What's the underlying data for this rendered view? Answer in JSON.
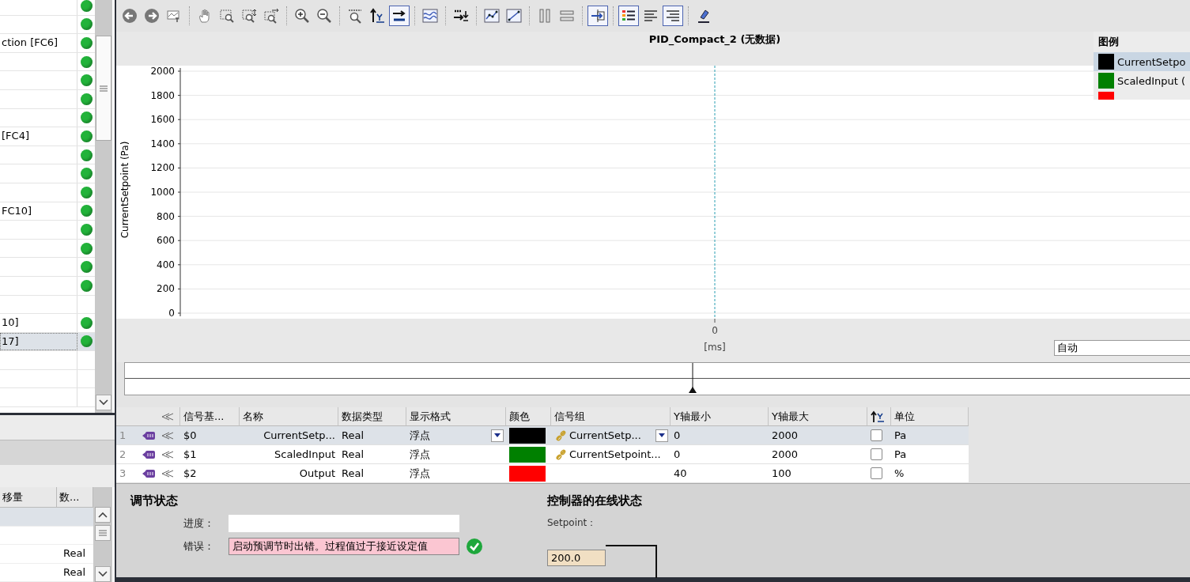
{
  "tree": {
    "rows": [
      {
        "ok": true,
        "selected": false
      },
      {
        "ok": true,
        "selected": false
      },
      {
        "label": "ction [FC6]",
        "ok": true,
        "selected": false
      },
      {
        "ok": true,
        "selected": false
      },
      {
        "ok": true,
        "selected": false
      },
      {
        "ok": true,
        "selected": false
      },
      {
        "ok": true,
        "selected": false
      },
      {
        "label": "[FC4]",
        "ok": true,
        "selected": false
      },
      {
        "ok": true,
        "selected": false
      },
      {
        "ok": true,
        "selected": false
      },
      {
        "ok": true,
        "selected": false
      },
      {
        "label": "FC10]",
        "ok": true,
        "selected": false
      },
      {
        "ok": true,
        "selected": false
      },
      {
        "ok": true,
        "selected": false
      },
      {
        "ok": true,
        "selected": false
      },
      {
        "ok": true,
        "selected": false
      },
      {
        "ok": false,
        "selected": false
      },
      {
        "label": "10]",
        "ok": true,
        "selected": false
      },
      {
        "label": "17]",
        "ok": true,
        "selected": true
      },
      {
        "ok": false,
        "selected": false
      },
      {
        "ok": false,
        "selected": false
      },
      {
        "ok": false,
        "selected": false
      }
    ]
  },
  "variables": {
    "columns": [
      "移量",
      "数..."
    ],
    "rows": [
      {
        "selected": true
      },
      {
        "selected": false
      },
      {
        "type": "Real",
        "selected": false
      },
      {
        "type": "Real",
        "selected": false
      }
    ]
  },
  "toolbar": [
    {
      "kind": "back",
      "pressed": false
    },
    {
      "kind": "forward",
      "pressed": false
    },
    {
      "kind": "snapshot",
      "pressed": false
    },
    {
      "kind": "sep"
    },
    {
      "kind": "pan",
      "pressed": false
    },
    {
      "kind": "zoom-box",
      "pressed": false
    },
    {
      "kind": "zoom-vertical",
      "pressed": false
    },
    {
      "kind": "zoom-horizontal",
      "pressed": false
    },
    {
      "kind": "sep"
    },
    {
      "kind": "zoom-in",
      "pressed": false
    },
    {
      "kind": "zoom-out",
      "pressed": false
    },
    {
      "kind": "sep"
    },
    {
      "kind": "zoom-fit",
      "pressed": false
    },
    {
      "kind": "fit-y",
      "pressed": false
    },
    {
      "kind": "fit-x",
      "pressed": true
    },
    {
      "kind": "sep"
    },
    {
      "kind": "wave",
      "pressed": false
    },
    {
      "kind": "sep"
    },
    {
      "kind": "time-down",
      "pressed": false
    },
    {
      "kind": "sep"
    },
    {
      "kind": "line-points",
      "pressed": false
    },
    {
      "kind": "line",
      "pressed": false
    },
    {
      "kind": "sep"
    },
    {
      "kind": "split-v",
      "pressed": false
    },
    {
      "kind": "split-h",
      "pressed": false
    },
    {
      "kind": "sep"
    },
    {
      "kind": "split-pane",
      "pressed": true
    },
    {
      "kind": "sep"
    },
    {
      "kind": "legend",
      "pressed": true
    },
    {
      "kind": "align-left",
      "pressed": false
    },
    {
      "kind": "align-right",
      "pressed": true
    },
    {
      "kind": "sep"
    },
    {
      "kind": "export",
      "pressed": false
    }
  ],
  "chart": {
    "title": "PID_Compact_2 (无数据)",
    "x_axis_title": "[ms]",
    "y_axis_title": "CurrentSetpoint (Pa)",
    "y_tick_labels": [
      "2000",
      "1800",
      "1600",
      "1400",
      "1200",
      "1000",
      "800",
      "600",
      "400",
      "200",
      "0"
    ],
    "x_tick": "0",
    "legend": {
      "title": "图例",
      "items": [
        {
          "name": "CurrentSetpo",
          "color": "#000000",
          "selected": true
        },
        {
          "name": "ScaledInput (",
          "color": "#008000",
          "selected": false
        },
        {
          "color": "#ff0000",
          "selected": false
        }
      ]
    },
    "time_range": "自动"
  },
  "signals": {
    "columns": [
      "信号基...",
      "名称",
      "数据类型",
      "显示格式",
      "颜色",
      "信号组",
      "Y轴最小",
      "Y轴最大",
      "单位"
    ],
    "rows": [
      {
        "index": "1",
        "address": "$0",
        "name": "CurrentSetp...",
        "type": "Real",
        "format": "浮点",
        "color": "#000000",
        "group": "CurrentSetp...",
        "y_min": "0",
        "y_max": "2000",
        "auto_scale": false,
        "unit": "Pa",
        "selected": true
      },
      {
        "index": "2",
        "address": "$1",
        "name": "ScaledInput",
        "type": "Real",
        "format": "浮点",
        "color": "#008000",
        "group": "CurrentSetpoint...",
        "y_min": "0",
        "y_max": "2000",
        "auto_scale": false,
        "unit": "Pa",
        "selected": false
      },
      {
        "index": "3",
        "address": "$2",
        "name": "Output",
        "type": "Real",
        "format": "浮点",
        "color": "#ff0000",
        "y_min": "40",
        "y_max": "100",
        "auto_scale": false,
        "unit": "%",
        "selected": false
      }
    ]
  },
  "tuning": {
    "title": "调节状态",
    "progress_label": "进度：",
    "progress_level": {
      "level": 0
    },
    "error_label": "错误：",
    "error": "启动预调节时出错。过程值过于接近设定值",
    "online_title": "控制器的在线状态",
    "setpoint_label": "Setpoint：",
    "setpoint": "200.0"
  }
}
